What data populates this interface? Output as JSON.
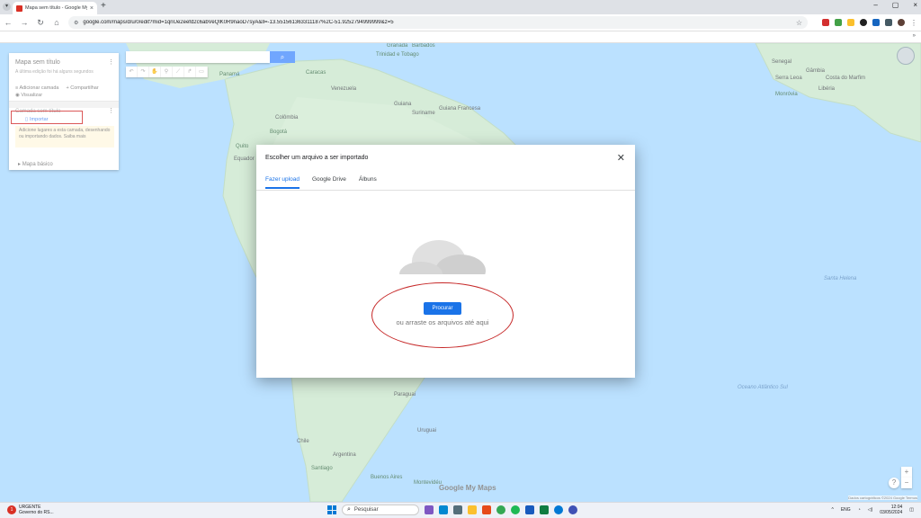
{
  "browser": {
    "tab_title": "Mapa sem título - Google My Maps",
    "tab_close": "×",
    "new_tab": "+",
    "url": "google.com/maps/d/u/0/edit?mid=1qnUe2eefd2c6abVeQlK0R9naoD7syA&ll=-13.551561363311187%2C-51.9252794999999&z=5",
    "window_controls": [
      "–",
      "▢",
      "×"
    ]
  },
  "panel": {
    "title": "Mapa sem título",
    "subtitle": "A última edição foi há alguns segundos",
    "add_layer": "Adicionar camada",
    "share": "Compartilhar",
    "preview": "Visualizar",
    "layer_name": "Camada sem título",
    "import_link": "Importar",
    "hint": "Adicione lugares a esta camada, desenhando ou importando dados. Saiba mais",
    "base_map": "Mapa básico"
  },
  "dialog": {
    "title": "Escolher um arquivo a ser importado",
    "close": "✕",
    "tabs": [
      "Fazer upload",
      "Google Drive",
      "Álbuns"
    ],
    "browse_button": "Procurar",
    "drag_text": "ou arraste os arquivos até aqui"
  },
  "map": {
    "labels": {
      "venezuela": "Venezuela",
      "colombia": "Colômbia",
      "guiana": "Guiana",
      "suriname": "Suriname",
      "guiana_francesa": "Guiana Francesa",
      "equador": "Equador",
      "trinidad": "Trinidad e Tobago",
      "barbados": "Barbados",
      "granada": "Granada",
      "caracas": "Caracas",
      "bogota": "Bogotá",
      "quito": "Quito",
      "panama": "Panamá",
      "senegal": "Senegal",
      "gambia": "Gâmbia",
      "serra_leoa": "Serra Leoa",
      "libéria": "Libéria",
      "costa_marfim": "Costa do Marfim",
      "monrovia": "Monróvia",
      "santa_helena": "Santa Helena",
      "uruguai": "Uruguai",
      "argentina": "Argentina",
      "chile": "Chile",
      "paraguai": "Paraguai",
      "montevideu": "Montevidéu",
      "buenos_aires": "Buenos Aires",
      "santiago": "Santiago",
      "ocean_south": "Oceano Atlântico Sul",
      "mapcolor_land": "#c8e6c9",
      "mapcolor_water": "#aadaff"
    },
    "logo": "Google My Maps",
    "footer": "Dados cartográficos ©2024 Google  Termos"
  },
  "taskbar": {
    "news_badge": "1",
    "news_title": "URGENTE",
    "news_sub": "Governo do RS...",
    "search_placeholder": "Pesquisar",
    "lang": "ENG",
    "time": "12:04",
    "date": "03/05/2024"
  },
  "colors": {
    "accent": "#1a73e8",
    "annotation_red": "#c62828",
    "map_water": "#aadaff",
    "map_land": "#cce8cf"
  }
}
